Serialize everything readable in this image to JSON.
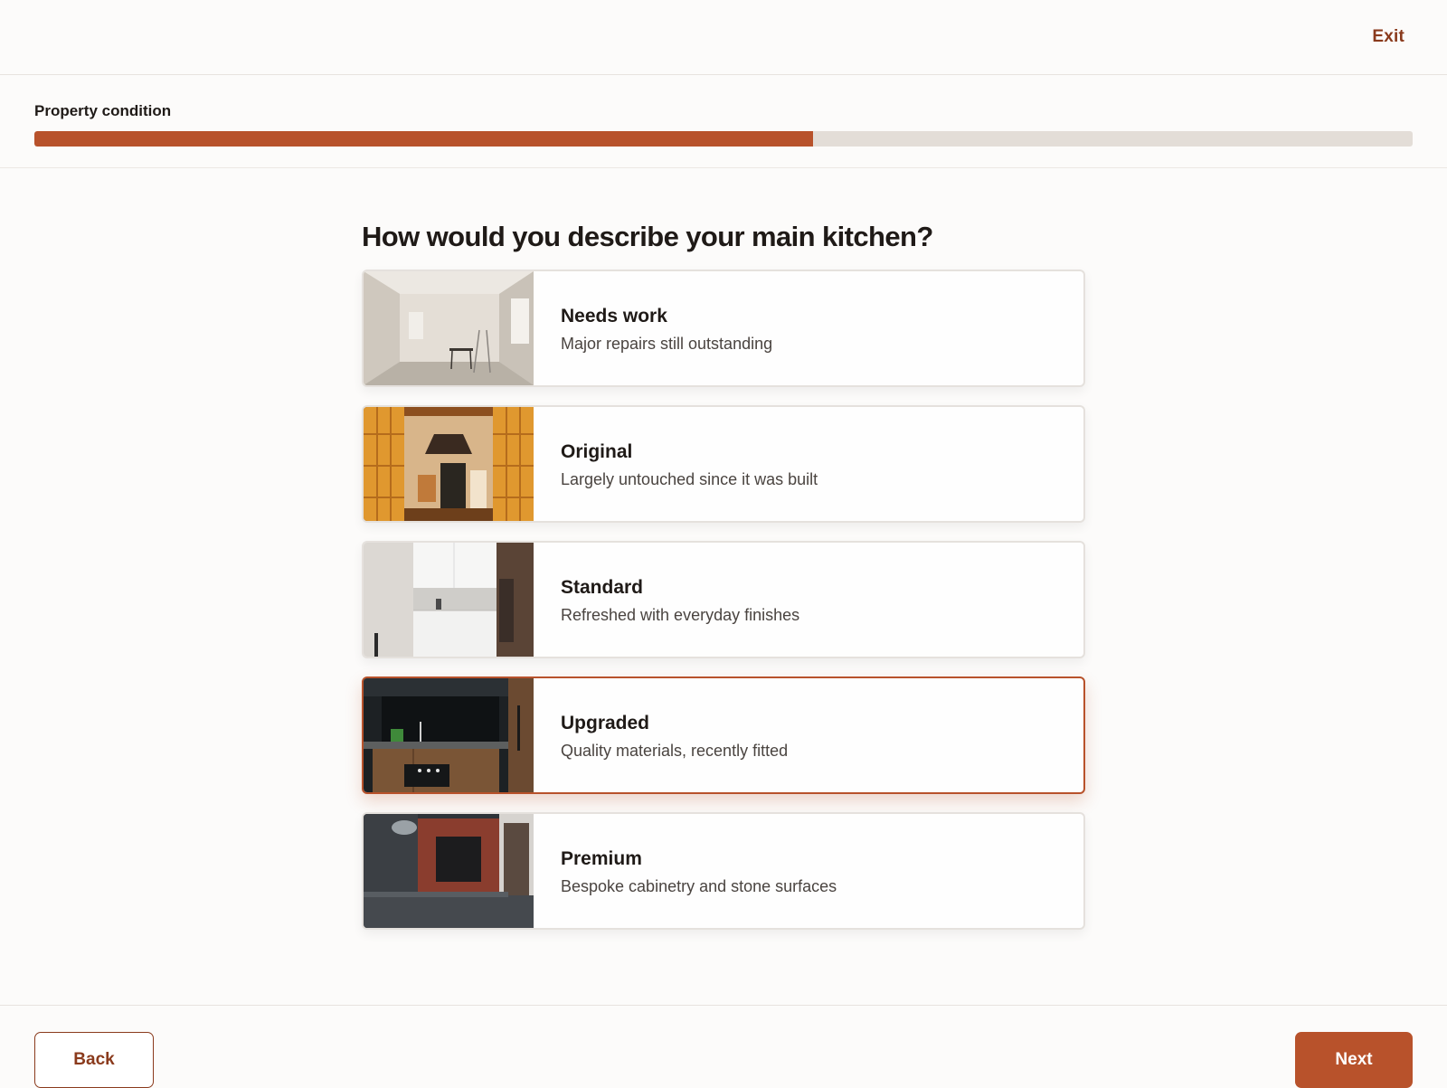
{
  "header": {
    "exit_label": "Exit"
  },
  "progress": {
    "label": "Property condition",
    "fraction": 0.565
  },
  "question": "How would you describe your main kitchen?",
  "options": [
    {
      "title": "Needs work",
      "description": "Major repairs still outstanding",
      "image_icon": "kitchen-photo-needs-work",
      "selected": false
    },
    {
      "title": "Original",
      "description": "Largely untouched since it was built",
      "image_icon": "kitchen-photo-original",
      "selected": false
    },
    {
      "title": "Standard",
      "description": "Refreshed with everyday finishes",
      "image_icon": "kitchen-photo-standard",
      "selected": false
    },
    {
      "title": "Upgraded",
      "description": "Quality materials, recently fitted",
      "image_icon": "kitchen-photo-upgraded",
      "selected": true
    },
    {
      "title": "Premium",
      "description": "Bespoke cabinetry and stone surfaces",
      "image_icon": "kitchen-photo-premium",
      "selected": false
    }
  ],
  "footer": {
    "back_label": "Back",
    "next_label": "Next"
  },
  "colors": {
    "accent": "#b8522b",
    "accent_dark": "#8a3a1c",
    "track": "#e3ddd7"
  }
}
